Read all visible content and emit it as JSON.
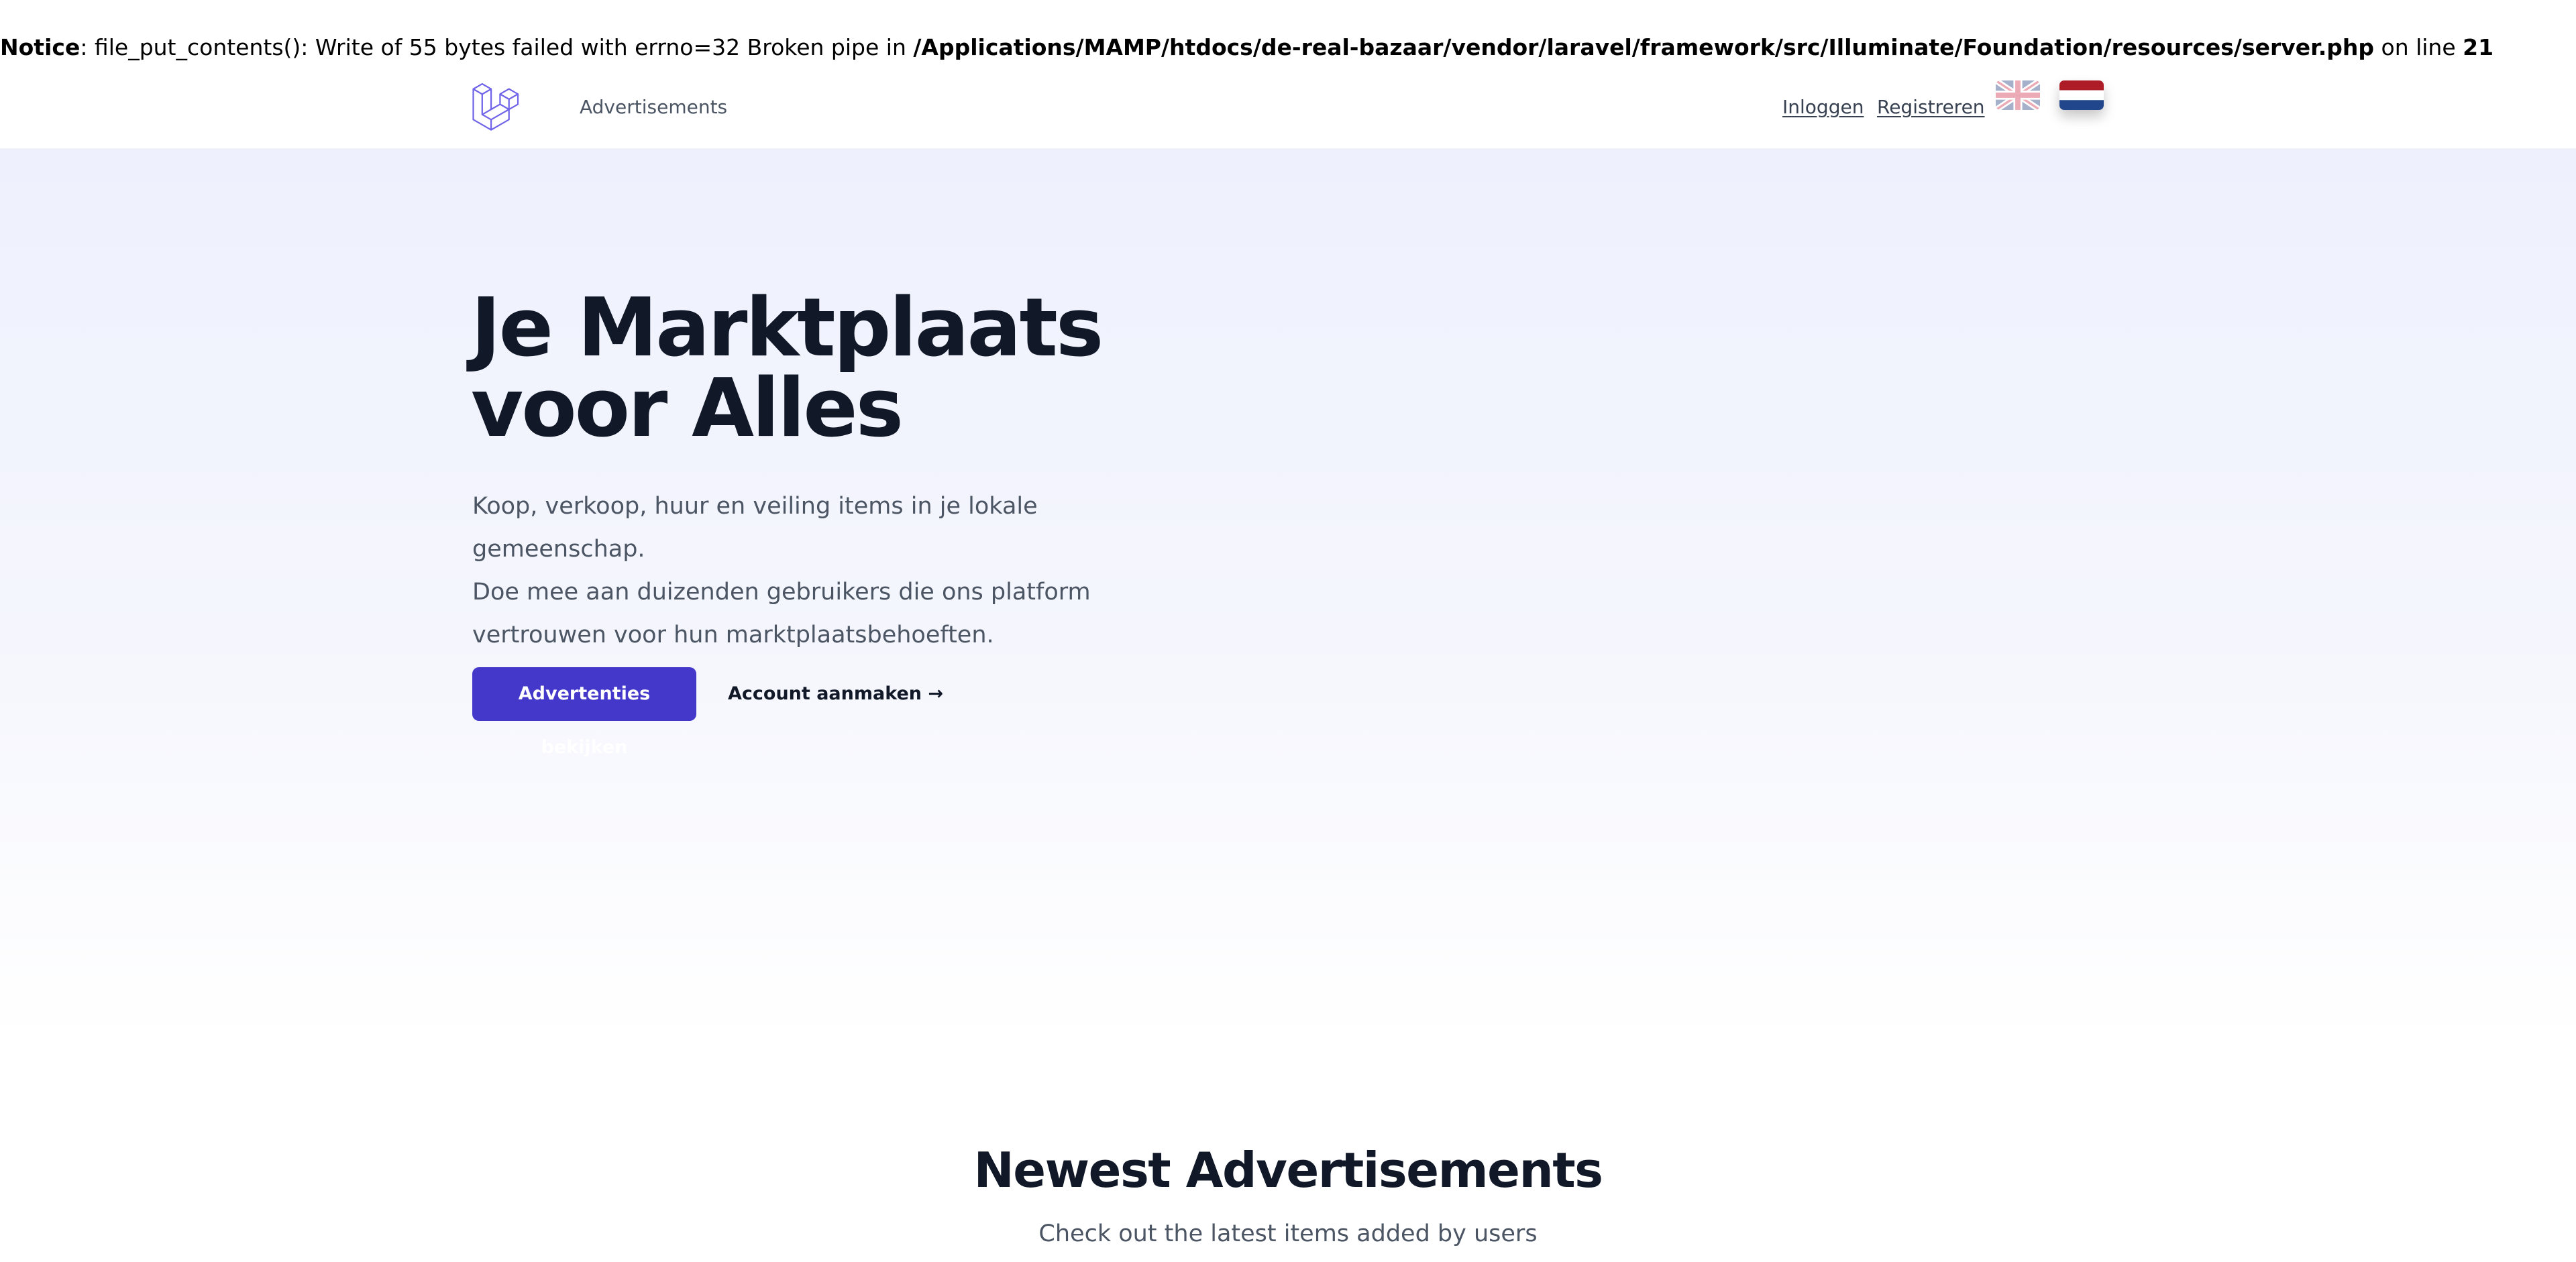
{
  "notice": {
    "label": "Notice",
    "message": ": file_put_contents(): Write of 55 bytes failed with errno=32 Broken pipe in ",
    "path": "/Applications/MAMP/htdocs/de-real-bazaar/vendor/laravel/framework/src/Illuminate/Foundation/resources/server.php",
    "line_text": " on line ",
    "line_number": "21"
  },
  "nav": {
    "logo_icon": "laravel-logo-icon",
    "advertisements_link": "Advertisements",
    "login_link": "Inloggen",
    "register_link": "Registreren",
    "languages": [
      {
        "icon": "uk-flag-icon",
        "active": false
      },
      {
        "icon": "netherlands-flag-icon",
        "active": true
      }
    ]
  },
  "hero": {
    "title_line1": "Je Marktplaats",
    "title_line2": "voor Alles",
    "description_line1": "Koop, verkoop, huur en veiling items in je lokale gemeenschap.",
    "description_line2": "Doe mee aan duizenden gebruikers die ons platform",
    "description_line3": "vertrouwen voor hun marktplaatsbehoeften.",
    "primary_button": "Advertenties bekijken",
    "secondary_button": "Account aanmaken →"
  },
  "newest": {
    "title": "Newest Advertisements",
    "subtitle": "Check out the latest items added by users"
  },
  "colors": {
    "accent": "#4338ca",
    "logo": "#6f63e8",
    "hero_bg": "#eef1fd"
  }
}
